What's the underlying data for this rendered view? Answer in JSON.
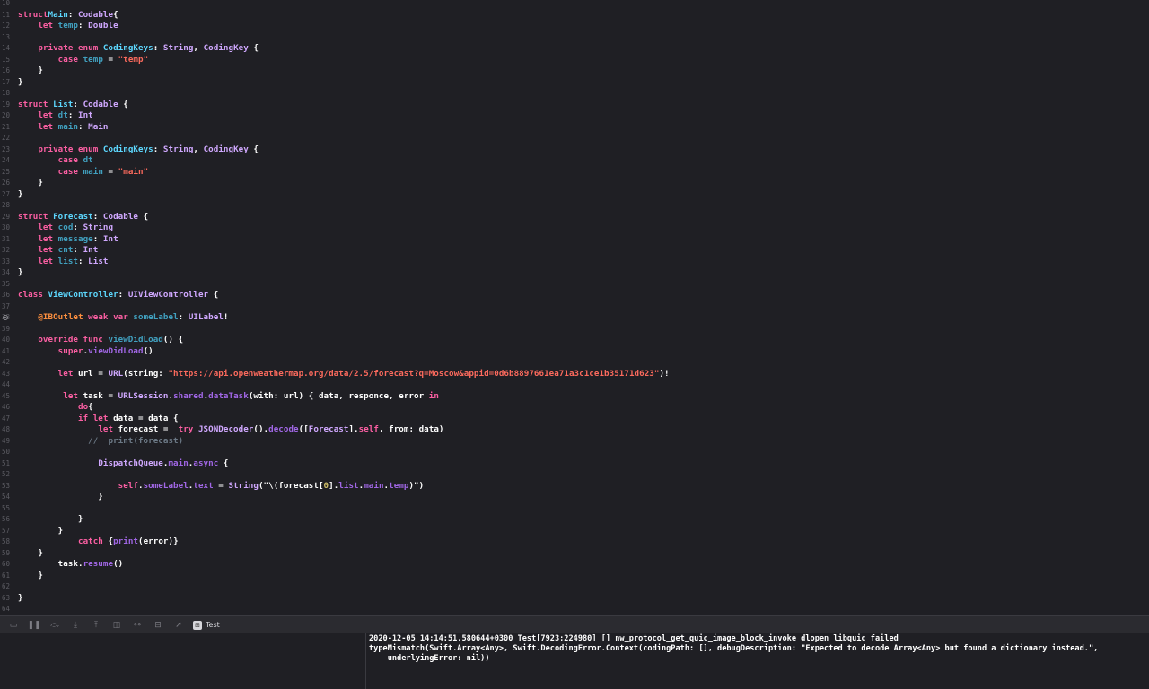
{
  "editor": {
    "lines": [
      {
        "n": "10",
        "segs": []
      },
      {
        "n": "11",
        "segs": [
          [
            "kw",
            "struct"
          ],
          [
            "",
            ""
          ],
          [
            "",
            ""
          ],
          [
            "tdecl",
            "Main"
          ],
          [
            "",
            ": "
          ],
          [
            "tref",
            "Codable"
          ],
          [
            "",
            "{"
          ]
        ]
      },
      {
        "n": "12",
        "segs": [
          [
            "",
            "    "
          ],
          [
            "kw",
            "let"
          ],
          [
            "",
            " "
          ],
          [
            "pdecl",
            "temp"
          ],
          [
            "",
            ": "
          ],
          [
            "tref",
            "Double"
          ]
        ]
      },
      {
        "n": "13",
        "segs": []
      },
      {
        "n": "14",
        "segs": [
          [
            "",
            "    "
          ],
          [
            "kw",
            "private enum"
          ],
          [
            "",
            " "
          ],
          [
            "tdecl",
            "CodingKeys"
          ],
          [
            "",
            ": "
          ],
          [
            "tref",
            "String"
          ],
          [
            "",
            ", "
          ],
          [
            "tref",
            "CodingKey"
          ],
          [
            "",
            " {"
          ]
        ]
      },
      {
        "n": "15",
        "segs": [
          [
            "",
            "        "
          ],
          [
            "kw",
            "case"
          ],
          [
            "",
            " "
          ],
          [
            "pdecl",
            "temp"
          ],
          [
            "",
            " = "
          ],
          [
            "str",
            "\"temp\""
          ]
        ]
      },
      {
        "n": "16",
        "segs": [
          [
            "",
            "    }"
          ]
        ]
      },
      {
        "n": "17",
        "segs": [
          [
            "",
            "}"
          ]
        ]
      },
      {
        "n": "18",
        "segs": []
      },
      {
        "n": "19",
        "segs": [
          [
            "kw",
            "struct"
          ],
          [
            "",
            " "
          ],
          [
            "tdecl",
            "List"
          ],
          [
            "",
            ": "
          ],
          [
            "tref",
            "Codable"
          ],
          [
            "",
            " {"
          ]
        ]
      },
      {
        "n": "20",
        "segs": [
          [
            "",
            "    "
          ],
          [
            "kw",
            "let"
          ],
          [
            "",
            " "
          ],
          [
            "pdecl",
            "dt"
          ],
          [
            "",
            ": "
          ],
          [
            "tref",
            "Int"
          ]
        ]
      },
      {
        "n": "21",
        "segs": [
          [
            "",
            "    "
          ],
          [
            "kw",
            "let"
          ],
          [
            "",
            " "
          ],
          [
            "pdecl",
            "main"
          ],
          [
            "",
            ": "
          ],
          [
            "tref",
            "Main"
          ]
        ]
      },
      {
        "n": "22",
        "segs": []
      },
      {
        "n": "23",
        "segs": [
          [
            "",
            "    "
          ],
          [
            "kw",
            "private enum"
          ],
          [
            "",
            " "
          ],
          [
            "tdecl",
            "CodingKeys"
          ],
          [
            "",
            ": "
          ],
          [
            "tref",
            "String"
          ],
          [
            "",
            ", "
          ],
          [
            "tref",
            "CodingKey"
          ],
          [
            "",
            " {"
          ]
        ]
      },
      {
        "n": "24",
        "segs": [
          [
            "",
            "        "
          ],
          [
            "kw",
            "case"
          ],
          [
            "",
            " "
          ],
          [
            "pdecl",
            "dt"
          ]
        ]
      },
      {
        "n": "25",
        "segs": [
          [
            "",
            "        "
          ],
          [
            "kw",
            "case"
          ],
          [
            "",
            " "
          ],
          [
            "pdecl",
            "main"
          ],
          [
            "",
            " = "
          ],
          [
            "str",
            "\"main\""
          ]
        ]
      },
      {
        "n": "26",
        "segs": [
          [
            "",
            "    }"
          ]
        ]
      },
      {
        "n": "27",
        "segs": [
          [
            "",
            "}"
          ]
        ]
      },
      {
        "n": "28",
        "segs": []
      },
      {
        "n": "29",
        "segs": [
          [
            "kw",
            "struct"
          ],
          [
            "",
            " "
          ],
          [
            "tdecl",
            "Forecast"
          ],
          [
            "",
            ": "
          ],
          [
            "tref",
            "Codable"
          ],
          [
            "",
            " {"
          ]
        ]
      },
      {
        "n": "30",
        "segs": [
          [
            "",
            "    "
          ],
          [
            "kw",
            "let"
          ],
          [
            "",
            " "
          ],
          [
            "pdecl",
            "cod"
          ],
          [
            "",
            ": "
          ],
          [
            "tref",
            "String"
          ]
        ]
      },
      {
        "n": "31",
        "segs": [
          [
            "",
            "    "
          ],
          [
            "kw",
            "let"
          ],
          [
            "",
            " "
          ],
          [
            "pdecl",
            "message"
          ],
          [
            "",
            ": "
          ],
          [
            "tref",
            "Int"
          ]
        ]
      },
      {
        "n": "32",
        "segs": [
          [
            "",
            "    "
          ],
          [
            "kw",
            "let"
          ],
          [
            "",
            " "
          ],
          [
            "pdecl",
            "cnt"
          ],
          [
            "",
            ": "
          ],
          [
            "tref",
            "Int"
          ]
        ]
      },
      {
        "n": "33",
        "segs": [
          [
            "",
            "    "
          ],
          [
            "kw",
            "let"
          ],
          [
            "",
            " "
          ],
          [
            "pdecl",
            "list"
          ],
          [
            "",
            ": "
          ],
          [
            "tref",
            "List"
          ]
        ]
      },
      {
        "n": "34",
        "segs": [
          [
            "",
            "}"
          ]
        ]
      },
      {
        "n": "35",
        "segs": []
      },
      {
        "n": "36",
        "segs": [
          [
            "kw",
            "class"
          ],
          [
            "",
            " "
          ],
          [
            "tdecl",
            "ViewController"
          ],
          [
            "",
            ": "
          ],
          [
            "tref",
            "UIViewController"
          ],
          [
            "",
            " {"
          ]
        ]
      },
      {
        "n": "37",
        "segs": []
      },
      {
        "n": "38",
        "bp": true,
        "segs": [
          [
            "",
            "    "
          ],
          [
            "attr",
            "@IBOutlet"
          ],
          [
            "",
            " "
          ],
          [
            "kw",
            "weak var"
          ],
          [
            "",
            " "
          ],
          [
            "pdecl",
            "someLabel"
          ],
          [
            "",
            ": "
          ],
          [
            "tref",
            "UILabel"
          ],
          [
            "",
            "!"
          ]
        ]
      },
      {
        "n": "39",
        "segs": []
      },
      {
        "n": "40",
        "segs": [
          [
            "",
            "    "
          ],
          [
            "kw",
            "override func"
          ],
          [
            "",
            " "
          ],
          [
            "pdecl",
            "viewDidLoad"
          ],
          [
            "",
            "() {"
          ]
        ]
      },
      {
        "n": "41",
        "segs": [
          [
            "",
            "        "
          ],
          [
            "kw",
            "super"
          ],
          [
            "",
            "."
          ],
          [
            "pref",
            "viewDidLoad"
          ],
          [
            "",
            "()"
          ]
        ]
      },
      {
        "n": "42",
        "segs": []
      },
      {
        "n": "43",
        "segs": [
          [
            "",
            "        "
          ],
          [
            "kw",
            "let"
          ],
          [
            "",
            " url = "
          ],
          [
            "tref",
            "URL"
          ],
          [
            "",
            "(string: "
          ],
          [
            "str",
            "\"https://api.openweathermap.org/data/2.5/forecast?q=Moscow&appid=0d6b8897661ea71a3c1ce1b35171d623\""
          ],
          [
            "",
            ")!"
          ]
        ]
      },
      {
        "n": "44",
        "segs": []
      },
      {
        "n": "45",
        "segs": [
          [
            "",
            "         "
          ],
          [
            "kw",
            "let"
          ],
          [
            "",
            " task = "
          ],
          [
            "tref",
            "URLSession"
          ],
          [
            "",
            "."
          ],
          [
            "pref",
            "shared"
          ],
          [
            "",
            "."
          ],
          [
            "pref",
            "dataTask"
          ],
          [
            "",
            "(with: url) { data, responce, error "
          ],
          [
            "kw",
            "in"
          ]
        ]
      },
      {
        "n": "46",
        "segs": [
          [
            "",
            "            "
          ],
          [
            "kw",
            "do"
          ],
          [
            "",
            "{"
          ]
        ]
      },
      {
        "n": "47",
        "segs": [
          [
            "",
            "            "
          ],
          [
            "kw",
            "if let"
          ],
          [
            "",
            " data = data {"
          ]
        ]
      },
      {
        "n": "48",
        "segs": [
          [
            "",
            "                "
          ],
          [
            "kw",
            "let"
          ],
          [
            "",
            " forecast =  "
          ],
          [
            "kw",
            "try"
          ],
          [
            "",
            " "
          ],
          [
            "tref",
            "JSONDecoder"
          ],
          [
            "",
            "()."
          ],
          [
            "pref",
            "decode"
          ],
          [
            "",
            "(["
          ],
          [
            "tref",
            "Forecast"
          ],
          [
            "",
            "]."
          ],
          [
            "kw",
            "self"
          ],
          [
            "",
            ", from: data)"
          ]
        ]
      },
      {
        "n": "49",
        "segs": [
          [
            "",
            "              "
          ],
          [
            "cm",
            "//  print(forecast)"
          ]
        ]
      },
      {
        "n": "50",
        "segs": []
      },
      {
        "n": "51",
        "segs": [
          [
            "",
            "                "
          ],
          [
            "tref",
            "DispatchQueue"
          ],
          [
            "",
            "."
          ],
          [
            "pref",
            "main"
          ],
          [
            "",
            "."
          ],
          [
            "pref",
            "async"
          ],
          [
            "",
            " {"
          ]
        ]
      },
      {
        "n": "52",
        "segs": []
      },
      {
        "n": "53",
        "segs": [
          [
            "",
            "                    "
          ],
          [
            "kw",
            "self"
          ],
          [
            "",
            "."
          ],
          [
            "pref",
            "someLabel"
          ],
          [
            "",
            "."
          ],
          [
            "pref",
            "text"
          ],
          [
            "",
            " = "
          ],
          [
            "tref",
            "String"
          ],
          [
            "",
            "(\"\\(forecast["
          ],
          [
            "num",
            "0"
          ],
          [
            "",
            "]."
          ],
          [
            "pref",
            "list"
          ],
          [
            "",
            "."
          ],
          [
            "pref",
            "main"
          ],
          [
            "",
            "."
          ],
          [
            "pref",
            "temp"
          ],
          [
            "",
            ")\")"
          ]
        ]
      },
      {
        "n": "54",
        "segs": [
          [
            "",
            "                }"
          ]
        ]
      },
      {
        "n": "55",
        "segs": []
      },
      {
        "n": "56",
        "segs": [
          [
            "",
            "            }"
          ]
        ]
      },
      {
        "n": "57",
        "segs": [
          [
            "",
            "        }"
          ]
        ]
      },
      {
        "n": "58",
        "segs": [
          [
            "",
            "            "
          ],
          [
            "kw",
            "catch"
          ],
          [
            "",
            " {"
          ],
          [
            "pref",
            "print"
          ],
          [
            "",
            "(error)}"
          ]
        ]
      },
      {
        "n": "59",
        "segs": [
          [
            "",
            "    }"
          ]
        ]
      },
      {
        "n": "60",
        "segs": [
          [
            "",
            "        task."
          ],
          [
            "pref",
            "resume"
          ],
          [
            "",
            "()"
          ]
        ]
      },
      {
        "n": "61",
        "segs": [
          [
            "",
            "    }"
          ]
        ]
      },
      {
        "n": "62",
        "segs": []
      },
      {
        "n": "63",
        "segs": [
          [
            "",
            "}"
          ]
        ]
      },
      {
        "n": "64",
        "segs": []
      }
    ]
  },
  "debug_bar": {
    "icons": [
      "hide-debug-area-icon",
      "pause-icon",
      "step-over-icon",
      "step-into-icon",
      "step-out-icon",
      "view-hierarchy-icon",
      "memory-graph-icon",
      "environment-overrides-icon",
      "location-icon"
    ],
    "target_label": "Test"
  },
  "console": {
    "lines": [
      "2020-12-05 14:14:51.580644+0300 Test[7923:224980] [] nw_protocol_get_quic_image_block_invoke dlopen libquic failed",
      "typeMismatch(Swift.Array<Any>, Swift.DecodingError.Context(codingPath: [], debugDescription: \"Expected to decode Array<Any> but found a dictionary instead.\",",
      "    underlyingError: nil))"
    ]
  }
}
